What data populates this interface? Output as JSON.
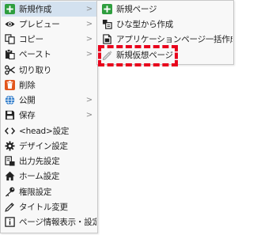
{
  "main_menu": {
    "items": [
      {
        "label": "新規作成",
        "icon": "add-icon",
        "has_submenu": true,
        "highlighted": true
      },
      {
        "label": "プレビュー",
        "icon": "eye-icon",
        "has_submenu": true,
        "highlighted": false
      },
      {
        "label": "コピー",
        "icon": "copy-icon",
        "has_submenu": true,
        "highlighted": false
      },
      {
        "label": "ペースト",
        "icon": "paste-icon",
        "has_submenu": true,
        "highlighted": false
      },
      {
        "label": "切り取り",
        "icon": "scissors-icon",
        "has_submenu": false,
        "highlighted": false
      },
      {
        "label": "削除",
        "icon": "trash-icon",
        "has_submenu": false,
        "highlighted": false
      },
      {
        "label": "公開",
        "icon": "globe-icon",
        "has_submenu": true,
        "highlighted": false
      },
      {
        "label": "保存",
        "icon": "floppy-icon",
        "has_submenu": true,
        "highlighted": false
      },
      {
        "label": "<head>設定",
        "icon": "code-icon",
        "has_submenu": false,
        "highlighted": false
      },
      {
        "label": "デザイン設定",
        "icon": "gear-icon",
        "has_submenu": false,
        "highlighted": false
      },
      {
        "label": "出力先設定",
        "icon": "output-icon",
        "has_submenu": false,
        "highlighted": false
      },
      {
        "label": "ホーム設定",
        "icon": "home-icon",
        "has_submenu": false,
        "highlighted": false
      },
      {
        "label": "権限設定",
        "icon": "key-icon",
        "has_submenu": false,
        "highlighted": false
      },
      {
        "label": "タイトル変更",
        "icon": "pencil-icon",
        "has_submenu": false,
        "highlighted": false
      },
      {
        "label": "ページ情報表示・設定",
        "icon": "info-icon",
        "has_submenu": false,
        "highlighted": false
      }
    ],
    "submenu_arrow": ">"
  },
  "sub_menu": {
    "items": [
      {
        "label": "新規ページ",
        "icon": "add-icon"
      },
      {
        "label": "ひな型から作成",
        "icon": "template-icon"
      },
      {
        "label": "アプリケーションページ一括作成",
        "icon": "document-icon"
      },
      {
        "label": "新規仮想ページ",
        "icon": "virtual-page-icon",
        "emphasized": true
      }
    ]
  },
  "colors": {
    "highlight": "#d3e1ef",
    "emphasis_border": "#e8001c",
    "menu_background": "#f8f8f8",
    "add_icon": "#2e9e3e",
    "trash_icon": "#e2551c",
    "globe_icon": "#2a78c8"
  }
}
